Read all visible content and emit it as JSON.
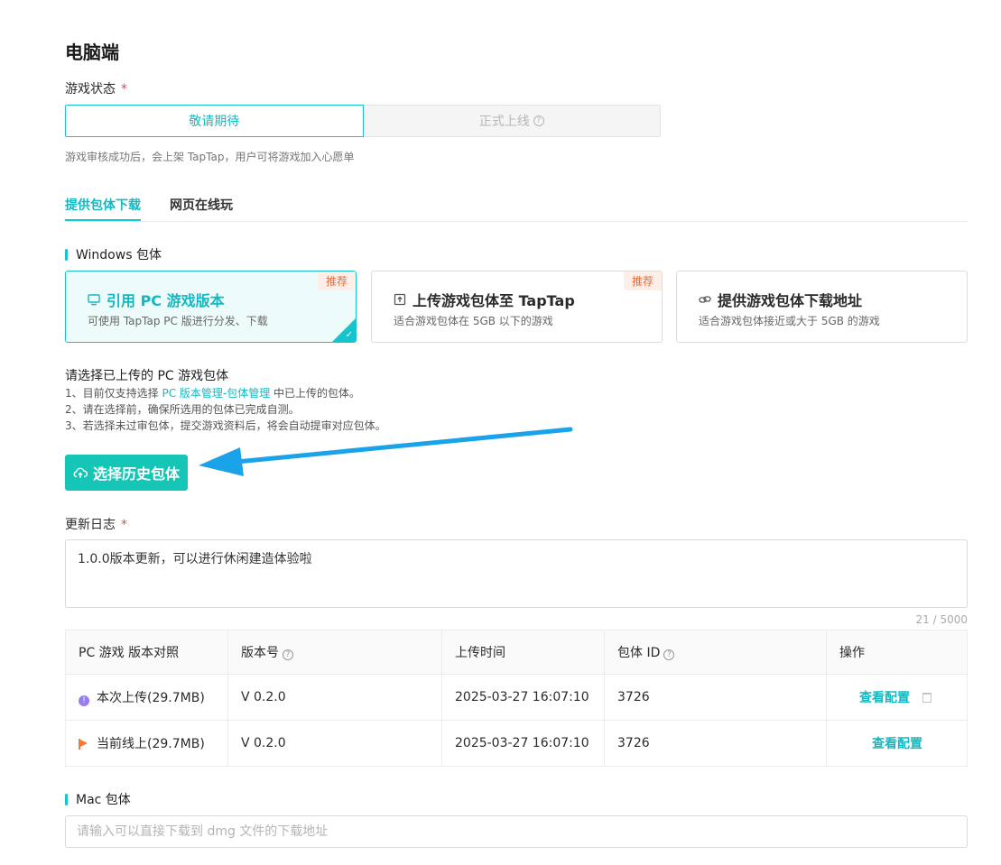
{
  "page_title": "电脑端",
  "game_status": {
    "label": "游戏状态",
    "required_mark": "*",
    "options": [
      "敬请期待",
      "正式上线"
    ],
    "hint": "游戏审核成功后，会上架 TapTap，用户可将游戏加入心愿单"
  },
  "tabs": [
    "提供包体下载",
    "网页在线玩"
  ],
  "windows": {
    "section_title": "Windows 包体",
    "cards": [
      {
        "title": "引用 PC 游戏版本",
        "desc": "可使用 TapTap PC 版进行分发、下载",
        "badge": "推荐"
      },
      {
        "title": "上传游戏包体至 TapTap",
        "desc": "适合游戏包体在 5GB 以下的游戏",
        "badge": "推荐"
      },
      {
        "title": "提供游戏包体下载地址",
        "desc": "适合游戏包体接近或大于 5GB 的游戏"
      }
    ]
  },
  "intro": {
    "title": "请选择已上传的 PC 游戏包体",
    "line1_pre": "1、目前仅支持选择 ",
    "line1_link": "PC 版本管理-包体管理",
    "line1_post": " 中已上传的包体。",
    "line2": "2、请在选择前，确保所选用的包体已完成自测。",
    "line3": "3、若选择未过审包体，提交游戏资料后，将会自动提审对应包体。"
  },
  "select_button": "选择历史包体",
  "changelog": {
    "label": "更新日志",
    "required_mark": "*",
    "value": "1.0.0版本更新，可以进行休闲建造体验啦",
    "counter": "21 / 5000"
  },
  "table": {
    "headers": [
      "PC 游戏 版本对照",
      "版本号",
      "上传时间",
      "包体 ID",
      "操作"
    ],
    "rows": [
      {
        "label": "本次上传(29.7MB)",
        "version": "V 0.2.0",
        "time": "2025-03-27 16:07:10",
        "id": "3726",
        "action": "查看配置"
      },
      {
        "label": "当前线上(29.7MB)",
        "version": "V 0.2.0",
        "time": "2025-03-27 16:07:10",
        "id": "3726",
        "action": "查看配置"
      }
    ]
  },
  "mac": {
    "section_title": "Mac 包体",
    "placeholder": "请输入可以直接下载到 dmg 文件的下载地址"
  },
  "colors": {
    "accent": "#15c5ce",
    "button": "#15c5b6",
    "badge_text": "#ef6a3a",
    "arrow": "#1aa3e8"
  }
}
